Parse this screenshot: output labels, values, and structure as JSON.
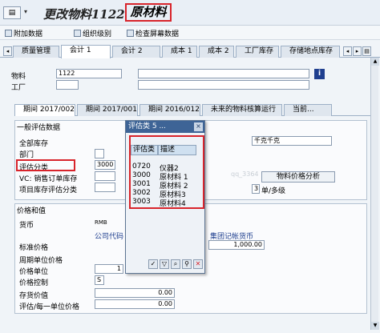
{
  "window": {
    "title": "更改物料1122",
    "material_type": "原材料",
    "menu_icon": "menu-icon"
  },
  "toolbar": {
    "items": [
      {
        "label": "附加数据",
        "icon": "additional-data-icon"
      },
      {
        "label": "组织级别",
        "icon": "org-levels-icon"
      },
      {
        "label": "检查屏幕数据",
        "icon": "check-screen-icon"
      }
    ]
  },
  "tabs": [
    {
      "label": "质量管理"
    },
    {
      "label": "会计 1"
    },
    {
      "label": "会计 2"
    },
    {
      "label": "成本 1"
    },
    {
      "label": "成本 2"
    },
    {
      "label": "工厂库存"
    },
    {
      "label": "存储地点库存"
    }
  ],
  "header": {
    "material_label": "物料",
    "material_value": "1122",
    "plant_label": "工厂",
    "info_button": "i"
  },
  "subtabs": [
    {
      "label": "期间 2017/002"
    },
    {
      "label": "期间 2017/001"
    },
    {
      "label": "期间 2016/012"
    },
    {
      "label": "未来的物料核算运行"
    },
    {
      "label": "当前..."
    }
  ],
  "general_valuation": {
    "section_title": "一般评估数据",
    "fields": {
      "total_stock_label": "全部库存",
      "division_label": "部门",
      "valuation_class_label": "评估分类",
      "valuation_class_value": "3000",
      "vc_sales_order_label": "VC: 销售订单库存",
      "project_stock_label": "项目库存评估分类"
    },
    "unit_value": "千克千克",
    "price_control_indicator": "3",
    "price_determination_label": "单/多级",
    "material_price_analysis_button": "物料价格分析"
  },
  "prices_values": {
    "section_title": "价格和值",
    "currency_label": "货币",
    "currency_code": "RMB",
    "company_code_currency_label": "公司代码",
    "group_currency_label": "集团记帐货币",
    "standard_price_label": "标准价格",
    "standard_price_value": "1,000.00",
    "periodic_unit_price_label": "周期单位价格",
    "price_unit_label": "价格单位",
    "price_unit_value": "1",
    "price_control_label": "价格控制",
    "price_control_value": "S",
    "inventory_value_label": "存货价值",
    "inventory_value": "0.00",
    "valuation_per_unit_label": "评估/每一单位价格",
    "valuation_per_unit_value": "0.00"
  },
  "popup": {
    "title": "评估类 5 ...",
    "col_class": "评估类",
    "col_description": "描述",
    "rows": [
      {
        "code": "0720",
        "desc": "仪器2"
      },
      {
        "code": "3000",
        "desc": "原材料 1"
      },
      {
        "code": "3001",
        "desc": "原材料 2"
      },
      {
        "code": "3002",
        "desc": "原材料3"
      },
      {
        "code": "3003",
        "desc": "原材料4"
      }
    ]
  },
  "watermark": {
    "text": "qq_3364"
  },
  "colors": {
    "highlight_red": "#d8242b",
    "popup_title_bg": "#3e6496",
    "info_button_bg": "#1f3f8f"
  }
}
